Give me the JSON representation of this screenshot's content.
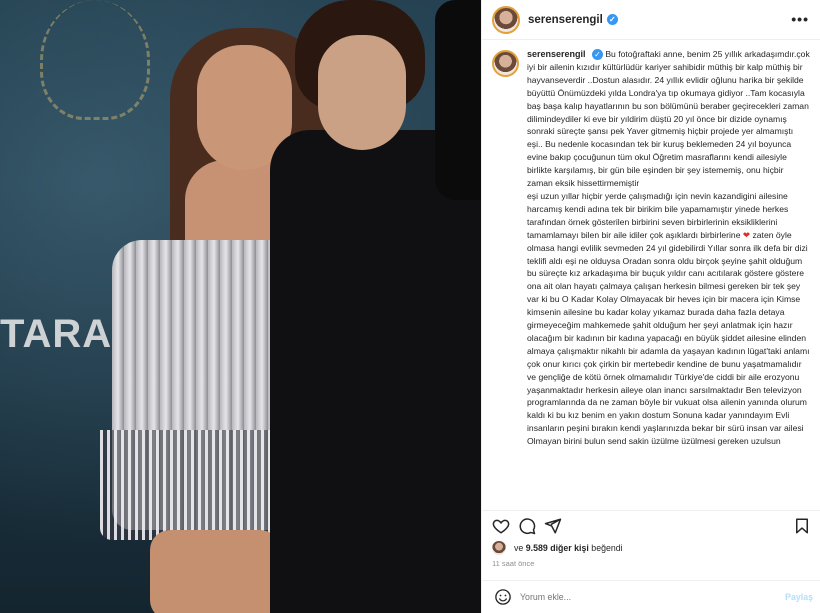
{
  "post": {
    "username": "serenserengil",
    "verified_mark": "✓",
    "more_label": "•••"
  },
  "photo": {
    "banner_text": "TARA"
  },
  "caption": {
    "username": "serenserengil",
    "paragraphs": [
      "Bu fotoğraftaki anne, benim 25 yıllık arkadaşımdır.çok iyi bir ailenin kızıdır kültürlüdür kariyer sahibidir müthiş bir kalp müthiş bir hayvanseverdir ..Dostun alasıdır. 24 yıllık evlidir oğlunu harika bir şekilde büyüttü Önümüzdeki yılda Londra'ya tıp okumaya gidiyor ..Tam kocasıyla baş başa kalıp hayatlarının bu son bölümünü beraber geçirecekleri zaman dilimindeydiler ki eve bir yıldirim düştü 20 yıl önce bir dizide oynamış sonraki süreçte şansı pek Yaver gitmemiş hiçbir projede yer almamıştı eşi.. Bu nedenle kocasından tek bir kuruş beklemeden 24 yıl boyunca evine bakıp çocuğunun tüm okul Öğretim masraflarını kendi ailesiyle birlikte karşılamış, bir gün bile eşinden bir şey istememiş, onu hiçbir zaman eksik hissettirmemiştir",
      "eşi uzun yıllar hiçbir yerde çalışmadığı için nevin kazandigini ailesine harcamış kendi adına tek bir birikim bile yapamamıştır yinede herkes tarafından örnek gösterilen birbirini seven birbirlerinin eksikliklerini tamamlamayı bilen bir aile idiler çok aşıklardı birbirlerine",
      "zaten öyle olmasa hangi evlilik sevmeden 24 yıl gidebilirdi Yıllar sonra ilk defa bir dizi teklifi aldı eşi ne olduysa Oradan sonra oldu birçok şeyine şahit olduğum bu süreçte kız arkadaşıma bir buçuk yıldır canı acıtılarak göstere göstere ona ait olan hayatı çalmaya çalışan herkesin bilmesi gereken bir tek şey var ki bu O Kadar Kolay Olmayacak bir heves için bir macera için Kimse kimsenin ailesine bu kadar kolay yıkamaz burada daha fazla detaya girmeyeceğim mahkemede şahit olduğum her şeyi anlatmak için hazır olacağım bir kadının bir kadına yapacağı en büyük şiddet ailesine elinden almaya çalışmaktır nikahlı bir adamla da yaşayan kadının lügat'taki anlamı çok onur kırıcı çok çirkin bir mertebedir kendine de bunu yaşatmamalıdır ve gençliğe de kötü örnek olmamalıdır Türkiye'de ciddi bir aile erozyonu yaşanmaktadır herkesin aileye olan inancı sarsılmaktadır Ben televizyon programlarında da ne zaman böyle bir vukuat olsa ailenin yanında olurum kaldı ki bu kız benim en yakın dostum Sonuna kadar yanındayım Evli insanların peşini bırakın kendi yaşlarınızda bekar bir sürü insan var ailesi Olmayan birini bulun send sakin üzülme üzülmesi gereken uzulsun"
    ],
    "heart": "❤"
  },
  "likes": {
    "prefix": "ve",
    "count": "9.589 diğer kişi",
    "suffix": "beğendi"
  },
  "time_ago": "11 saat önce",
  "comment": {
    "placeholder": "Yorum ekle...",
    "share_label": "Paylaş"
  },
  "icons": [
    "heart-icon",
    "comment-icon",
    "share-icon",
    "bookmark-icon",
    "emoji-icon"
  ]
}
